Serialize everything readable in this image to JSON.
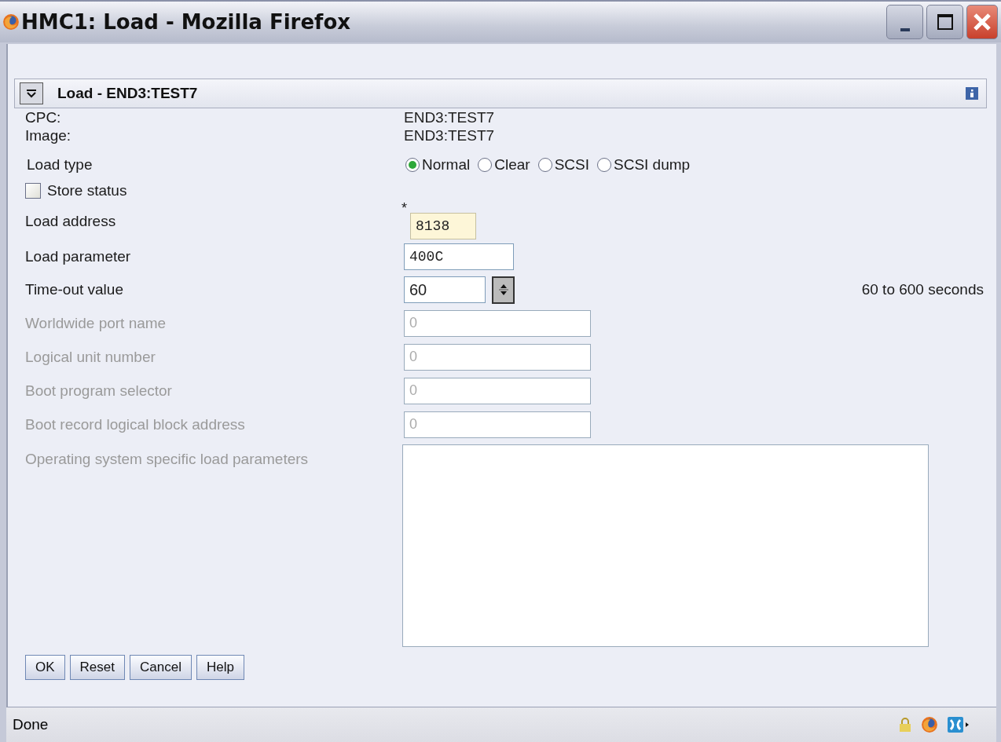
{
  "window": {
    "title": "HMC1: Load - Mozilla Firefox"
  },
  "panel": {
    "title": "Load - END3:TEST7"
  },
  "info": [
    {
      "label": "CPC:",
      "value": "END3:TEST7"
    },
    {
      "label": "Image:",
      "value": "END3:TEST7"
    }
  ],
  "load_type": {
    "label": "Load type",
    "options": [
      {
        "label": "Normal",
        "selected": true
      },
      {
        "label": "Clear",
        "selected": false
      },
      {
        "label": "SCSI",
        "selected": false
      },
      {
        "label": "SCSI dump",
        "selected": false
      }
    ]
  },
  "store_status": {
    "label": "Store status",
    "checked": false
  },
  "fields": [
    {
      "kind": "address",
      "label": "Load address",
      "value": "8138",
      "required_mark": "*",
      "disabled": false
    },
    {
      "kind": "parameter",
      "label": "Load parameter",
      "value": "400C",
      "disabled": false
    },
    {
      "kind": "spinner",
      "label": "Time-out value",
      "value": "60",
      "hint": "60 to 600 seconds",
      "disabled": false
    },
    {
      "kind": "text",
      "label": "Worldwide port name",
      "value": "0",
      "disabled": true
    },
    {
      "kind": "text",
      "label": "Logical unit number",
      "value": "0",
      "disabled": true
    },
    {
      "kind": "text",
      "label": "Boot program selector",
      "value": "0",
      "disabled": true
    },
    {
      "kind": "text",
      "label": "Boot record logical block address",
      "value": "0",
      "disabled": true
    },
    {
      "kind": "textarea",
      "label": "Operating system specific load parameters",
      "disabled": true
    }
  ],
  "buttons": [
    "OK",
    "Reset",
    "Cancel",
    "Help"
  ],
  "status_bar": {
    "text": "Done"
  }
}
